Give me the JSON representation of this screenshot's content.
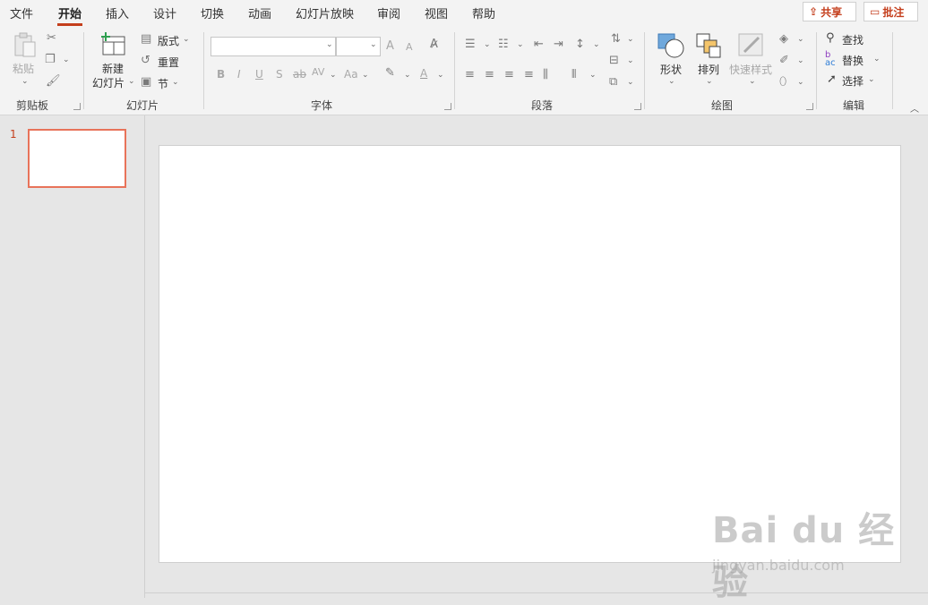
{
  "tabs": [
    "文件",
    "开始",
    "插入",
    "设计",
    "切换",
    "动画",
    "幻灯片放映",
    "审阅",
    "视图",
    "帮助"
  ],
  "active_tab": "开始",
  "share_label": "共享",
  "comments_label": "批注",
  "clipboard": {
    "paste": "粘贴",
    "group": "剪贴板"
  },
  "slides": {
    "new_slide": "新建",
    "new_slide2": "幻灯片",
    "layout": "版式",
    "reset": "重置",
    "section": "节",
    "group": "幻灯片"
  },
  "font": {
    "group": "字体",
    "bold": "B",
    "italic": "I",
    "underline": "U",
    "shadow": "S",
    "strike": "ab",
    "spacing": "AV",
    "case": "Aa",
    "grow": "A",
    "shrink": "A"
  },
  "paragraph": {
    "group": "段落"
  },
  "drawing": {
    "shapes": "形状",
    "arrange": "排列",
    "quick_styles": "快速样式",
    "group": "绘图"
  },
  "editing": {
    "find": "查找",
    "replace": "替换",
    "select": "选择",
    "group": "编辑"
  },
  "slide_panel": {
    "number": "1"
  },
  "watermark": {
    "main": "Bai du 经验",
    "sub": "jingyan.baidu.com"
  },
  "colors": {
    "accent": "#c43e1c",
    "thumb_border": "#e8735a"
  }
}
